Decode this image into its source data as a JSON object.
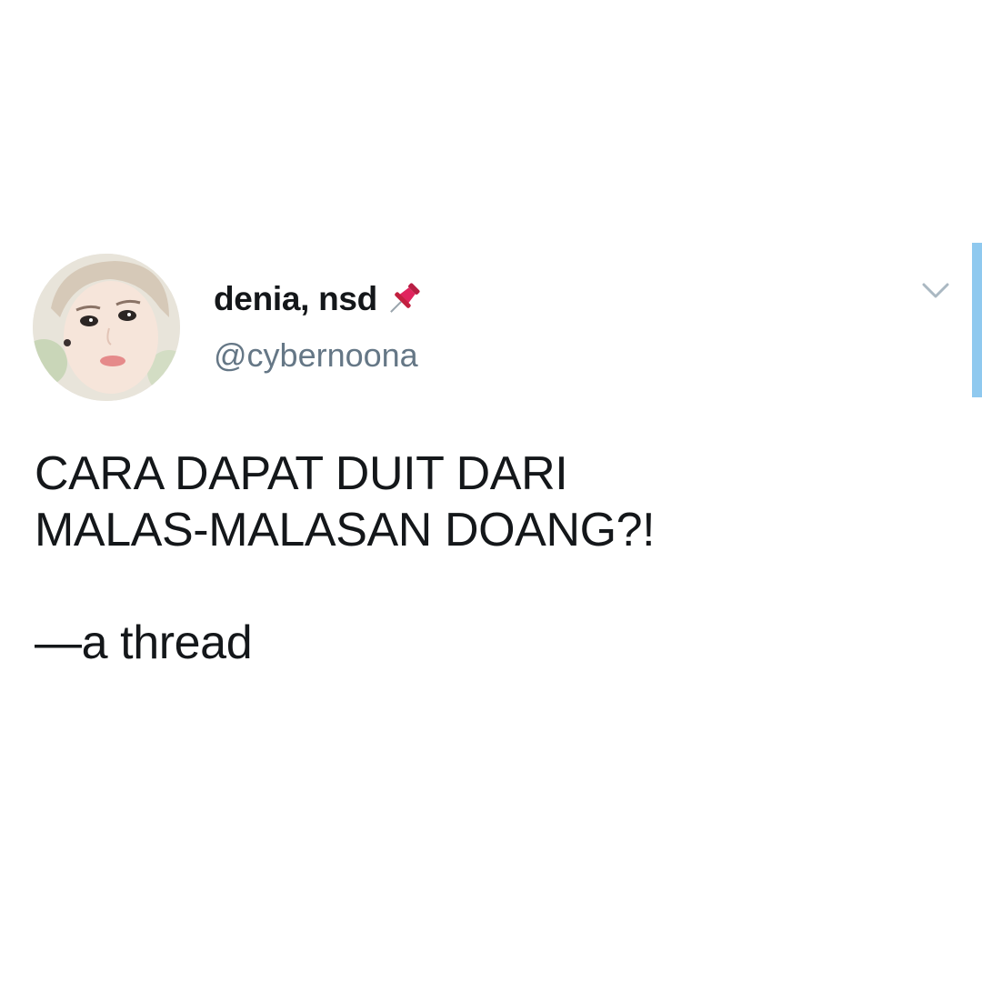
{
  "author": {
    "display_name": "denia, nsd",
    "badge_icon": "pushpin-icon",
    "handle": "@cybernoona",
    "avatar_icon": "avatar-photo"
  },
  "tweet": {
    "line1": "CARA DAPAT DUIT DARI",
    "line2": "MALAS-MALASAN DOANG?!",
    "line3": "—a thread"
  },
  "menu": {
    "icon": "chevron-down-icon"
  },
  "colors": {
    "name": "#14171a",
    "handle": "#657786",
    "chevron": "#aab8c2",
    "scroll_indicator": "#8fc9ef",
    "pin": "#e0245e"
  }
}
